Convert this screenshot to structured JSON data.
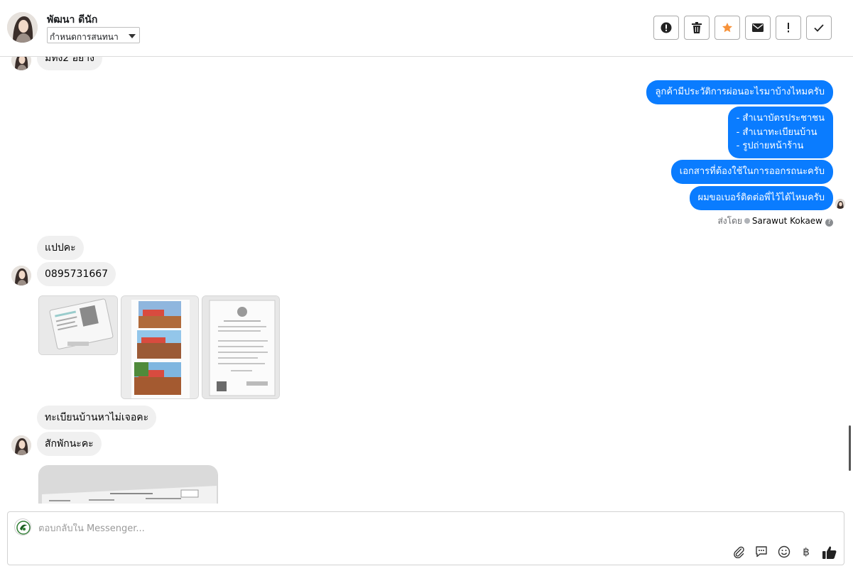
{
  "header": {
    "contact_name": "พัฒนา ดีนัก",
    "conversation_select": "กำหนดการสนทนา",
    "actions": [
      "spam-icon",
      "trash-icon",
      "star-icon",
      "mail-icon",
      "exclamation-icon",
      "check-icon"
    ],
    "star_color": "#f7923a"
  },
  "messages": {
    "in_top": "มีทั้ง2 อย่าง",
    "out_1": "ลูกค้ามีประวัติการผ่อนอะไรมาบ้างไหมครับ",
    "out_2_lines": [
      "- สำเนาบัตรประชาชน",
      "- สำเนาทะเบียนบ้าน",
      "- รูปถ่ายหน้าร้าน"
    ],
    "out_3": "เอกสารที่ต้องใช้ในการออกรถนะครับ",
    "out_4": "ผมขอเบอร์ติดต่อพี่ไว้ได้ไหมครับ",
    "sent_by_prefix": "ส่งโดย",
    "sent_by_name": "Sarawut Kokaew",
    "in_1": "แปปคะ",
    "in_2": "0895731667",
    "in_3": "ทะเบียนบ้านหาไม่เจอคะ",
    "in_4": "สักพักนะคะ",
    "accent_color": "#0a7cff"
  },
  "composer": {
    "placeholder": "ตอบกลับใน Messenger...",
    "tools": [
      "paperclip-icon",
      "saved-reply-icon",
      "emoji-icon",
      "baht-icon",
      "thumbs-up-icon"
    ],
    "baht_symbol": "฿"
  }
}
